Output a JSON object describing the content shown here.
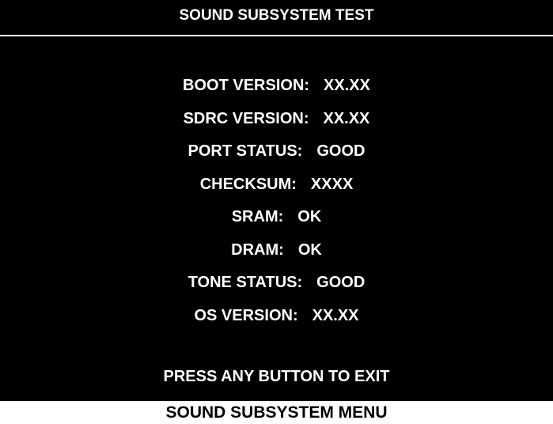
{
  "screen": {
    "title": "SOUND SUBSYSTEM TEST",
    "rows": [
      {
        "label": "BOOT VERSION:",
        "value": "XX.XX"
      },
      {
        "label": "SDRC VERSION:",
        "value": "XX.XX"
      },
      {
        "label": "PORT STATUS:",
        "value": "GOOD"
      },
      {
        "label": "CHECKSUM:",
        "value": "XXXX"
      },
      {
        "label": "SRAM:",
        "value": "OK"
      },
      {
        "label": "DRAM:",
        "value": "OK"
      },
      {
        "label": "TONE STATUS:",
        "value": "GOOD"
      },
      {
        "label": "OS VERSION:",
        "value": "XX.XX"
      }
    ],
    "footer": "PRESS ANY BUTTON TO EXIT"
  },
  "caption": "SOUND SUBSYSTEM MENU",
  "colors": {
    "screen_background": "#000000",
    "screen_text": "#ffffff",
    "caption_text": "#000000"
  }
}
